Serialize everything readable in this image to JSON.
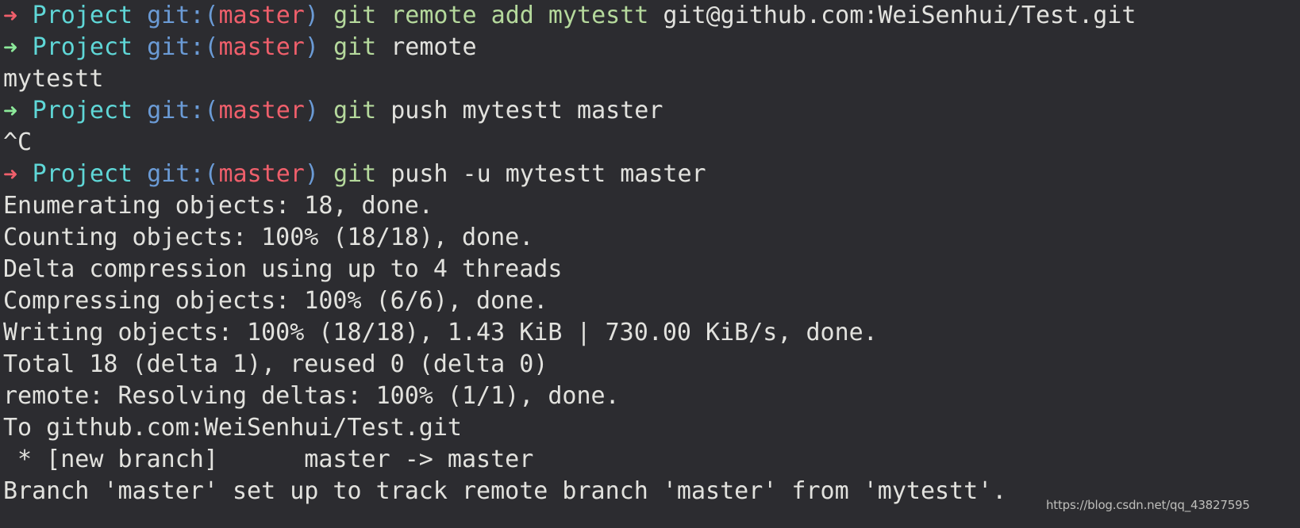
{
  "terminal": {
    "background_color": "#2c2c30",
    "foreground_color": "#e2e2de",
    "title": "zsh terminal session",
    "palette": {
      "prompt_arrow_ok": "#8ce99a",
      "prompt_arrow_error": "#ef5f6b",
      "prompt_dir": "#5fd7d7",
      "prompt_git_label": "#6b9bd6",
      "prompt_branch": "#ef5f6b",
      "command_name": "#b5d99c",
      "output_text": "#e2e2de"
    },
    "lines": [
      {
        "kind": "prompt",
        "arrow": "➜",
        "arrow_status": "error",
        "dir": "Project",
        "git_label": "git:",
        "paren_open": "(",
        "branch": "master",
        "paren_close": ")",
        "command": "git remote add mytestt",
        "args": "git@github.com:WeiSenhui/Test.git"
      },
      {
        "kind": "prompt",
        "arrow": "➜",
        "arrow_status": "ok",
        "dir": "Project",
        "git_label": "git:",
        "paren_open": "(",
        "branch": "master",
        "paren_close": ")",
        "command": "git",
        "args": "remote"
      },
      {
        "kind": "output",
        "text": "mytestt"
      },
      {
        "kind": "prompt",
        "arrow": "➜",
        "arrow_status": "ok",
        "dir": "Project",
        "git_label": "git:",
        "paren_open": "(",
        "branch": "master",
        "paren_close": ")",
        "command": "git",
        "args": "push mytestt master"
      },
      {
        "kind": "output",
        "text": "^C"
      },
      {
        "kind": "prompt",
        "arrow": "➜",
        "arrow_status": "error",
        "dir": "Project",
        "git_label": "git:",
        "paren_open": "(",
        "branch": "master",
        "paren_close": ")",
        "command": "git",
        "args": "push -u mytestt master"
      },
      {
        "kind": "output",
        "text": "Enumerating objects: 18, done."
      },
      {
        "kind": "output",
        "text": "Counting objects: 100% (18/18), done."
      },
      {
        "kind": "output",
        "text": "Delta compression using up to 4 threads"
      },
      {
        "kind": "output",
        "text": "Compressing objects: 100% (6/6), done."
      },
      {
        "kind": "output",
        "text": "Writing objects: 100% (18/18), 1.43 KiB | 730.00 KiB/s, done."
      },
      {
        "kind": "output",
        "text": "Total 18 (delta 1), reused 0 (delta 0)"
      },
      {
        "kind": "output",
        "text": "remote: Resolving deltas: 100% (1/1), done."
      },
      {
        "kind": "output",
        "text": "To github.com:WeiSenhui/Test.git"
      },
      {
        "kind": "output",
        "text": " * [new branch]      master -> master"
      },
      {
        "kind": "output",
        "text": "Branch 'master' set up to track remote branch 'master' from 'mytestt'."
      }
    ]
  },
  "watermark": {
    "text": "https://blog.csdn.net/qq_43827595"
  }
}
